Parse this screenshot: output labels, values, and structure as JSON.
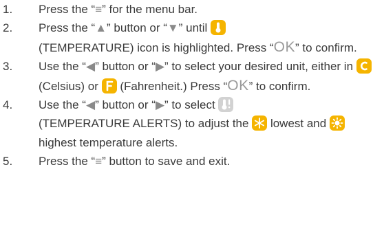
{
  "steps": [
    {
      "num": "1.",
      "t1": "Press the “",
      "glyph": "≡",
      "t2": "” for the menu bar."
    },
    {
      "num": "2.",
      "t1": "Press the “",
      "up": "▲",
      "t2": "” button or “",
      "down": "▼",
      "t3": "” until",
      "t4": "(TEMPERATURE) icon is highlighted. Press “",
      "ok": "OK",
      "t5": "” to confirm."
    },
    {
      "num": "3.",
      "t1": "Use the “",
      "left": "◀",
      "t2": "” button or “",
      "right": "▶",
      "t3": "” to select your desired unit, either in",
      "t4": "(Celsius) or",
      "t5": "(Fahrenheit.) Press “",
      "ok": "OK",
      "t6": "” to confirm."
    },
    {
      "num": "4.",
      "t1": "Use the “",
      "left": "◀",
      "t2": "” button or “",
      "right": "▶",
      "t3": "” to select",
      "t4": "(TEMPERATURE ALERTS) to adjust the",
      "t5": "lowest and",
      "t6": "highest temperature alerts."
    },
    {
      "num": "5.",
      "t1": "Press the “",
      "glyph": "≡",
      "t2": "” button to save and exit."
    }
  ],
  "icons": {
    "thermometer": "thermometer-icon",
    "celsius": "celsius-icon",
    "fahrenheit": "fahrenheit-icon",
    "temperature_alert": "temperature-alert-icon",
    "snowflake": "snowflake-icon",
    "sun": "sun-icon"
  },
  "colors": {
    "text": "#3a3a3a",
    "icon_orange": "#f5b400",
    "icon_gray": "#c8c8c8",
    "glyph_gray": "#8a8a8a"
  }
}
